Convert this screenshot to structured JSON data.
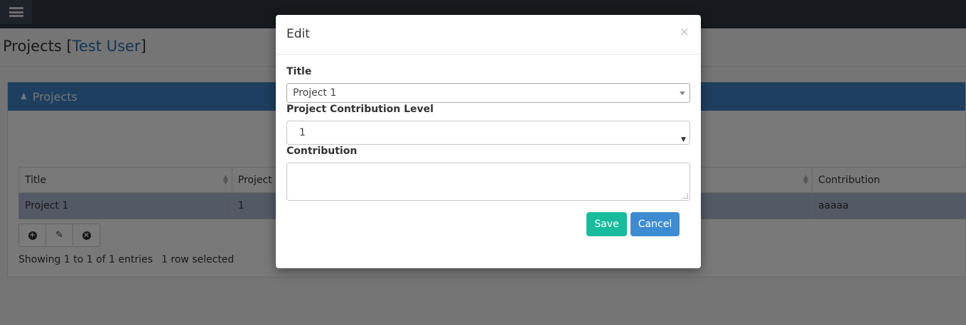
{
  "page": {
    "title": "Projects",
    "user": "Test User"
  },
  "panel": {
    "heading": "Projects"
  },
  "table": {
    "columns": [
      "Title",
      "Project C",
      "",
      "Contribution"
    ],
    "rows": [
      [
        "Project 1",
        "1",
        "",
        "aaaaa"
      ]
    ],
    "info": "Showing 1 to 1 of 1 entries",
    "selected": "1 row selected"
  },
  "toolbar": {
    "icons": [
      "plus-circle-icon",
      "edit-icon",
      "remove-circle-icon"
    ]
  },
  "modal": {
    "title": "Edit",
    "close": "×",
    "title_label": "Title",
    "title_value": "Project 1",
    "level_label": "Project Contribution Level",
    "level_value": "1",
    "contribution_label": "Contribution",
    "contribution_value": "",
    "save_label": "Save",
    "cancel_label": "Cancel"
  },
  "colors": {
    "topbar": "#2c323d",
    "panel_heading": "#3c7fc0",
    "selected_row": "#a8b3cc",
    "save": "#18bc9c",
    "cancel": "#3d8bd0"
  }
}
